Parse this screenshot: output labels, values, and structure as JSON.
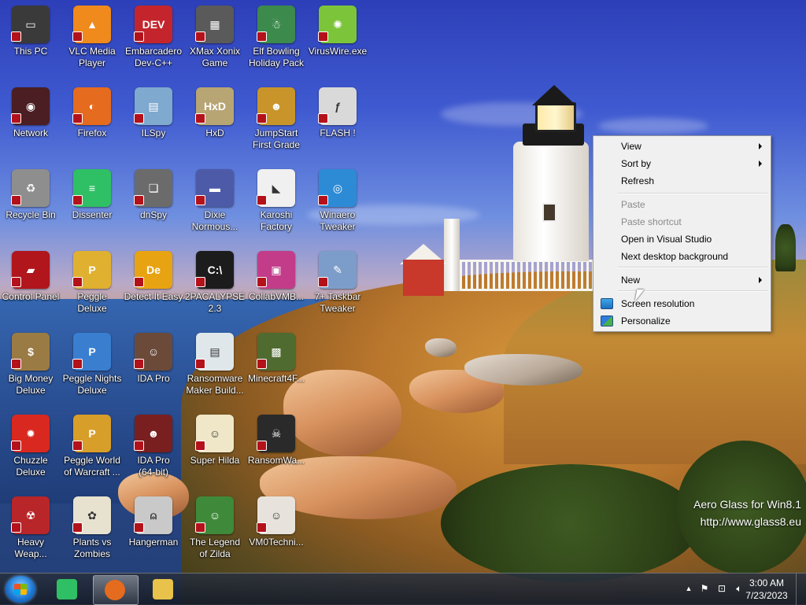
{
  "desktop_icons": [
    {
      "label": "This PC",
      "icon": "computer-icon",
      "color": "#3a3a3a",
      "glyph": "▭"
    },
    {
      "label": "VLC Media\nPlayer",
      "icon": "vlc-icon",
      "color": "#f08a1c",
      "glyph": "▲"
    },
    {
      "label": "Embarcadero\nDev-C++",
      "icon": "devcpp-icon",
      "color": "#c4252d",
      "glyph": "DEV"
    },
    {
      "label": "XMax Xonix\nGame",
      "icon": "xonix-icon",
      "color": "#5a5a5a",
      "glyph": "▦"
    },
    {
      "label": "Elf Bowling\nHoliday Pack",
      "icon": "elf-bowling-icon",
      "color": "#3d8a4d",
      "glyph": "☃"
    },
    {
      "label": "VirusWire.exe",
      "icon": "lime-icon",
      "color": "#7cc53a",
      "glyph": "✺"
    },
    {
      "label": "Network",
      "icon": "network-icon",
      "color": "#4a1e22",
      "glyph": "◉"
    },
    {
      "label": "Firefox",
      "icon": "firefox-icon",
      "color": "#e56b1f",
      "glyph": "◐"
    },
    {
      "label": "ILSpy",
      "icon": "ilspy-icon",
      "color": "#7fa9cf",
      "glyph": "▤"
    },
    {
      "label": "HxD",
      "icon": "hxd-icon",
      "color": "#b8a574",
      "glyph": "HxD"
    },
    {
      "label": "JumpStart\nFirst Grade",
      "icon": "jumpstart-icon",
      "color": "#c9952a",
      "glyph": "☻"
    },
    {
      "label": "FLASH !",
      "icon": "flash-icon",
      "color": "#d9d9d9",
      "glyph": "ƒ"
    },
    {
      "label": "Recycle Bin",
      "icon": "recycle-bin-icon",
      "color": "#8e8e8e",
      "glyph": "♻"
    },
    {
      "label": "Dissenter",
      "icon": "dissenter-icon",
      "color": "#2fbf64",
      "glyph": "≡"
    },
    {
      "label": "dnSpy",
      "icon": "dnspy-icon",
      "color": "#6b6b6b",
      "glyph": "❏"
    },
    {
      "label": "Dixie\nNormous...",
      "icon": "dixie-icon",
      "color": "#4d5aa8",
      "glyph": "▬"
    },
    {
      "label": "Karoshi\nFactory",
      "icon": "karoshi-icon",
      "color": "#f0f0f0",
      "glyph": "◣"
    },
    {
      "label": "Winaero\nTweaker",
      "icon": "winaero-icon",
      "color": "#2d8bd6",
      "glyph": "◎"
    },
    {
      "label": "Control Panel",
      "icon": "control-panel-icon",
      "color": "#b0161c",
      "glyph": "▰"
    },
    {
      "label": "Peggle Deluxe",
      "icon": "peggle-icon",
      "color": "#e0b030",
      "glyph": "P"
    },
    {
      "label": "Detect It Easy",
      "icon": "die-icon",
      "color": "#e8a313",
      "glyph": "De"
    },
    {
      "label": "2PACALYPSE\n2.3",
      "icon": "2pac-icon",
      "color": "#1c1c1c",
      "glyph": "C:\\"
    },
    {
      "label": "CollabVMB...",
      "icon": "collabvm-icon",
      "color": "#c23c8a",
      "glyph": "▣"
    },
    {
      "label": "7+ Taskbar\nTweaker",
      "icon": "taskbar-tweaker-icon",
      "color": "#7c9dc9",
      "glyph": "✎"
    },
    {
      "label": "Big Money\nDeluxe",
      "icon": "big-money-icon",
      "color": "#9b7b44",
      "glyph": "$"
    },
    {
      "label": "Peggle Nights\nDeluxe",
      "icon": "peggle-nights-icon",
      "color": "#3a7ed0",
      "glyph": "P"
    },
    {
      "label": "IDA Pro",
      "icon": "ida-icon",
      "color": "#6b4a3a",
      "glyph": "☺"
    },
    {
      "label": "Ransomware\nMaker Build...",
      "icon": "ransomware-maker-icon",
      "color": "#dfe7ea",
      "glyph": "▤"
    },
    {
      "label": "Minecraft4F...",
      "icon": "minecraft-icon",
      "color": "#4f6b30",
      "glyph": "▩"
    },
    {
      "label": "Chuzzle\nDeluxe",
      "icon": "chuzzle-icon",
      "color": "#d9281f",
      "glyph": "✹"
    },
    {
      "label": "Peggle World\nof Warcraft ...",
      "icon": "peggle-wow-icon",
      "color": "#d89e2a",
      "glyph": "P"
    },
    {
      "label": "IDA Pro\n(64-bit)",
      "icon": "ida64-icon",
      "color": "#7a1f1f",
      "glyph": "☻"
    },
    {
      "label": "Super Hilda",
      "icon": "super-hilda-icon",
      "color": "#efe7c8",
      "glyph": "☺"
    },
    {
      "label": "RansomWa...",
      "icon": "ransomwa-icon",
      "color": "#2a2a2a",
      "glyph": "☠"
    },
    {
      "label": "Heavy\nWeap...",
      "icon": "heavy-weapon-icon",
      "color": "#b8262a",
      "glyph": "☢"
    },
    {
      "label": "Plants vs\nZombies",
      "icon": "pvz-icon",
      "color": "#e7e2d0",
      "glyph": "✿"
    },
    {
      "label": "Hangerman",
      "icon": "hangerman-icon",
      "color": "#c9c9c9",
      "glyph": "⍝"
    },
    {
      "label": "The Legend\nof Zilda",
      "icon": "zilda-icon",
      "color": "#3f8a3a",
      "glyph": "☺"
    },
    {
      "label": "VM0Techni...",
      "icon": "vm0-icon",
      "color": "#e7e3dc",
      "glyph": "☺"
    }
  ],
  "context_menu": {
    "items": [
      {
        "label": "View",
        "submenu": true,
        "disabled": false
      },
      {
        "label": "Sort by",
        "submenu": true,
        "disabled": false
      },
      {
        "label": "Refresh",
        "submenu": false,
        "disabled": false
      },
      {
        "label": "Paste",
        "submenu": false,
        "disabled": true
      },
      {
        "label": "Paste shortcut",
        "submenu": false,
        "disabled": true
      },
      {
        "label": "Open in Visual Studio",
        "submenu": false,
        "disabled": false
      },
      {
        "label": "Next desktop background",
        "submenu": false,
        "disabled": false
      },
      {
        "label": "New",
        "submenu": true,
        "disabled": false
      },
      {
        "label": "Screen resolution",
        "submenu": false,
        "disabled": false,
        "icon": "display-icon"
      },
      {
        "label": "Personalize",
        "submenu": false,
        "disabled": false,
        "icon": "personalize-icon"
      }
    ]
  },
  "watermark": {
    "line1": "Aero Glass for Win8.1",
    "line2": "http://www.glass8.eu"
  },
  "taskbar": {
    "start_icon": "windows-start-icon",
    "pinned": [
      {
        "icon": "dissenter-icon",
        "color": "#2fbf64",
        "active": false
      },
      {
        "icon": "firefox-icon",
        "color": "#e56b1f",
        "active": true
      },
      {
        "icon": "file-explorer-icon",
        "color": "#e8c24a",
        "active": false
      }
    ],
    "tray": {
      "chevron": "▲",
      "icons": [
        "action-center-flag-icon",
        "network-icon",
        "volume-icon"
      ],
      "time": "3:00 AM",
      "date": "7/23/2023"
    }
  }
}
